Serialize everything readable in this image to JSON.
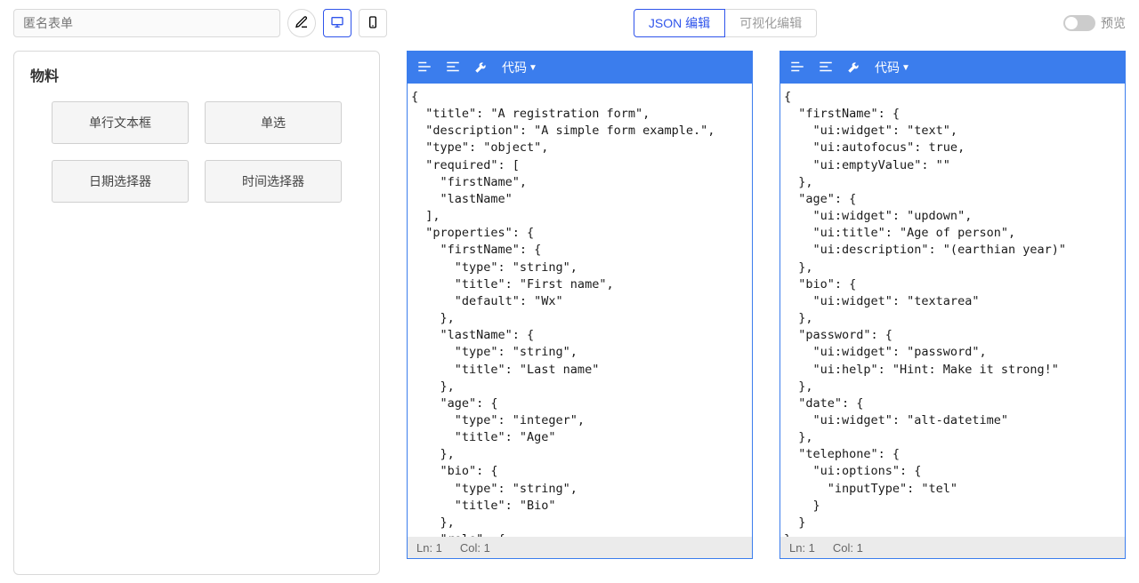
{
  "header": {
    "form_title_placeholder": "匿名表单",
    "tabs": {
      "json": "JSON 编辑",
      "visual": "可视化编辑"
    },
    "preview_label": "预览"
  },
  "materials": {
    "title": "物料",
    "items": [
      "单行文本框",
      "单选",
      "日期选择器",
      "时间选择器"
    ]
  },
  "editor_toolbar": {
    "code_label": "代码"
  },
  "editor_left": {
    "content": "{\n  \"title\": \"A registration form\",\n  \"description\": \"A simple form example.\",\n  \"type\": \"object\",\n  \"required\": [\n    \"firstName\",\n    \"lastName\"\n  ],\n  \"properties\": {\n    \"firstName\": {\n      \"type\": \"string\",\n      \"title\": \"First name\",\n      \"default\": \"Wx\"\n    },\n    \"lastName\": {\n      \"type\": \"string\",\n      \"title\": \"Last name\"\n    },\n    \"age\": {\n      \"type\": \"integer\",\n      \"title\": \"Age\"\n    },\n    \"bio\": {\n      \"type\": \"string\",\n      \"title\": \"Bio\"\n    },\n    \"role\": {\n      \"type\": \"string\",\n      \"title\": \"Role\",\n      \"enum\": [\n        \"Admin\",\n        \"Develop\"\n      ]",
    "status_ln": "Ln: 1",
    "status_col": "Col: 1"
  },
  "editor_right": {
    "content": "{\n  \"firstName\": {\n    \"ui:widget\": \"text\",\n    \"ui:autofocus\": true,\n    \"ui:emptyValue\": \"\"\n  },\n  \"age\": {\n    \"ui:widget\": \"updown\",\n    \"ui:title\": \"Age of person\",\n    \"ui:description\": \"(earthian year)\"\n  },\n  \"bio\": {\n    \"ui:widget\": \"textarea\"\n  },\n  \"password\": {\n    \"ui:widget\": \"password\",\n    \"ui:help\": \"Hint: Make it strong!\"\n  },\n  \"date\": {\n    \"ui:widget\": \"alt-datetime\"\n  },\n  \"telephone\": {\n    \"ui:options\": {\n      \"inputType\": \"tel\"\n    }\n  }\n}",
    "status_ln": "Ln: 1",
    "status_col": "Col: 1"
  }
}
